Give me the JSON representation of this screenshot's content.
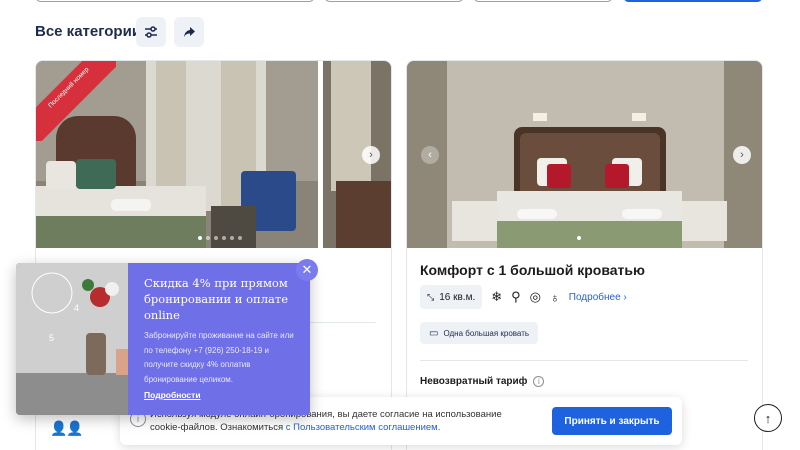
{
  "categories": {
    "title": "Все категории",
    "filter_icon": "sliders-icon",
    "share_icon": "share-arrow-icon"
  },
  "card_left": {
    "ribbon": "Последний номер",
    "photo_dots": 6,
    "photo_active_dot": 1
  },
  "card_right": {
    "title": "Комфорт с 1 большой кроватью",
    "area": "16 кв.м.",
    "amenities": [
      "snowflake-icon",
      "shower-icon",
      "mask-icon",
      "hairdryer-icon"
    ],
    "details_link": "Подробнее",
    "bed": "Одна большая кровать",
    "tariff": "Невозвратный тариф"
  },
  "promo": {
    "title": "Скидка 4% при прямом бронировании и оплате online",
    "description": "Забронируйте проживание на сайте или по телефону +7 (926) 250-18-19 и получите скидку 4% оплатив бронирование целиком.",
    "link": "Подробности"
  },
  "cookie": {
    "text": "Используя модуле онлайн-бронирования, вы даете согласие на использование cookie-файлов. Ознакомиться ",
    "link": "с Пользовательским соглашением.",
    "button": "Принять и закрыть"
  },
  "colors": {
    "accent": "#1f62e0",
    "ribbon": "#d6303c",
    "promo": "#6f6fe8",
    "heading": "#1d2b4c"
  }
}
